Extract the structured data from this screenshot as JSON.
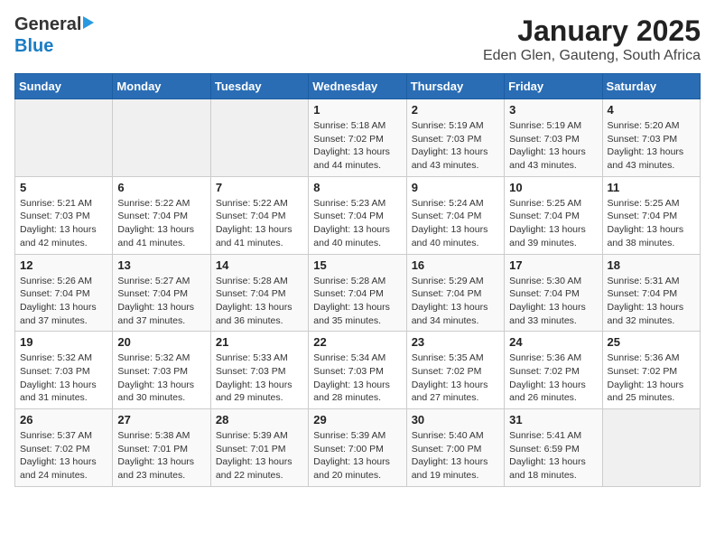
{
  "header": {
    "logo_general": "General",
    "logo_blue": "Blue",
    "title": "January 2025",
    "subtitle": "Eden Glen, Gauteng, South Africa"
  },
  "calendar": {
    "days_of_week": [
      "Sunday",
      "Monday",
      "Tuesday",
      "Wednesday",
      "Thursday",
      "Friday",
      "Saturday"
    ],
    "weeks": [
      [
        {
          "day": "",
          "info": ""
        },
        {
          "day": "",
          "info": ""
        },
        {
          "day": "",
          "info": ""
        },
        {
          "day": "1",
          "info": "Sunrise: 5:18 AM\nSunset: 7:02 PM\nDaylight: 13 hours\nand 44 minutes."
        },
        {
          "day": "2",
          "info": "Sunrise: 5:19 AM\nSunset: 7:03 PM\nDaylight: 13 hours\nand 43 minutes."
        },
        {
          "day": "3",
          "info": "Sunrise: 5:19 AM\nSunset: 7:03 PM\nDaylight: 13 hours\nand 43 minutes."
        },
        {
          "day": "4",
          "info": "Sunrise: 5:20 AM\nSunset: 7:03 PM\nDaylight: 13 hours\nand 43 minutes."
        }
      ],
      [
        {
          "day": "5",
          "info": "Sunrise: 5:21 AM\nSunset: 7:03 PM\nDaylight: 13 hours\nand 42 minutes."
        },
        {
          "day": "6",
          "info": "Sunrise: 5:22 AM\nSunset: 7:04 PM\nDaylight: 13 hours\nand 41 minutes."
        },
        {
          "day": "7",
          "info": "Sunrise: 5:22 AM\nSunset: 7:04 PM\nDaylight: 13 hours\nand 41 minutes."
        },
        {
          "day": "8",
          "info": "Sunrise: 5:23 AM\nSunset: 7:04 PM\nDaylight: 13 hours\nand 40 minutes."
        },
        {
          "day": "9",
          "info": "Sunrise: 5:24 AM\nSunset: 7:04 PM\nDaylight: 13 hours\nand 40 minutes."
        },
        {
          "day": "10",
          "info": "Sunrise: 5:25 AM\nSunset: 7:04 PM\nDaylight: 13 hours\nand 39 minutes."
        },
        {
          "day": "11",
          "info": "Sunrise: 5:25 AM\nSunset: 7:04 PM\nDaylight: 13 hours\nand 38 minutes."
        }
      ],
      [
        {
          "day": "12",
          "info": "Sunrise: 5:26 AM\nSunset: 7:04 PM\nDaylight: 13 hours\nand 37 minutes."
        },
        {
          "day": "13",
          "info": "Sunrise: 5:27 AM\nSunset: 7:04 PM\nDaylight: 13 hours\nand 37 minutes."
        },
        {
          "day": "14",
          "info": "Sunrise: 5:28 AM\nSunset: 7:04 PM\nDaylight: 13 hours\nand 36 minutes."
        },
        {
          "day": "15",
          "info": "Sunrise: 5:28 AM\nSunset: 7:04 PM\nDaylight: 13 hours\nand 35 minutes."
        },
        {
          "day": "16",
          "info": "Sunrise: 5:29 AM\nSunset: 7:04 PM\nDaylight: 13 hours\nand 34 minutes."
        },
        {
          "day": "17",
          "info": "Sunrise: 5:30 AM\nSunset: 7:04 PM\nDaylight: 13 hours\nand 33 minutes."
        },
        {
          "day": "18",
          "info": "Sunrise: 5:31 AM\nSunset: 7:04 PM\nDaylight: 13 hours\nand 32 minutes."
        }
      ],
      [
        {
          "day": "19",
          "info": "Sunrise: 5:32 AM\nSunset: 7:03 PM\nDaylight: 13 hours\nand 31 minutes."
        },
        {
          "day": "20",
          "info": "Sunrise: 5:32 AM\nSunset: 7:03 PM\nDaylight: 13 hours\nand 30 minutes."
        },
        {
          "day": "21",
          "info": "Sunrise: 5:33 AM\nSunset: 7:03 PM\nDaylight: 13 hours\nand 29 minutes."
        },
        {
          "day": "22",
          "info": "Sunrise: 5:34 AM\nSunset: 7:03 PM\nDaylight: 13 hours\nand 28 minutes."
        },
        {
          "day": "23",
          "info": "Sunrise: 5:35 AM\nSunset: 7:02 PM\nDaylight: 13 hours\nand 27 minutes."
        },
        {
          "day": "24",
          "info": "Sunrise: 5:36 AM\nSunset: 7:02 PM\nDaylight: 13 hours\nand 26 minutes."
        },
        {
          "day": "25",
          "info": "Sunrise: 5:36 AM\nSunset: 7:02 PM\nDaylight: 13 hours\nand 25 minutes."
        }
      ],
      [
        {
          "day": "26",
          "info": "Sunrise: 5:37 AM\nSunset: 7:02 PM\nDaylight: 13 hours\nand 24 minutes."
        },
        {
          "day": "27",
          "info": "Sunrise: 5:38 AM\nSunset: 7:01 PM\nDaylight: 13 hours\nand 23 minutes."
        },
        {
          "day": "28",
          "info": "Sunrise: 5:39 AM\nSunset: 7:01 PM\nDaylight: 13 hours\nand 22 minutes."
        },
        {
          "day": "29",
          "info": "Sunrise: 5:39 AM\nSunset: 7:00 PM\nDaylight: 13 hours\nand 20 minutes."
        },
        {
          "day": "30",
          "info": "Sunrise: 5:40 AM\nSunset: 7:00 PM\nDaylight: 13 hours\nand 19 minutes."
        },
        {
          "day": "31",
          "info": "Sunrise: 5:41 AM\nSunset: 6:59 PM\nDaylight: 13 hours\nand 18 minutes."
        },
        {
          "day": "",
          "info": ""
        }
      ]
    ]
  }
}
